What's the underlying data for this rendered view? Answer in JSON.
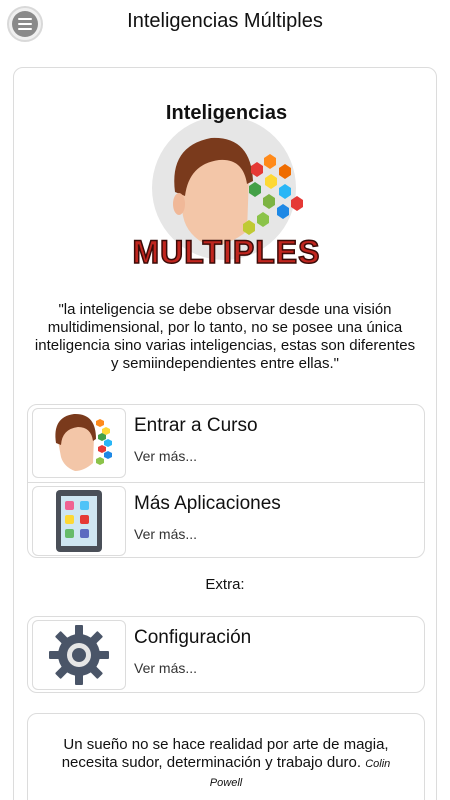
{
  "header": {
    "title": "Inteligencias Múltiples",
    "menu_icon": "menu-icon"
  },
  "hero": {
    "title": "Inteligencias",
    "subtitle": "MULTIPLES"
  },
  "intro_quote": "\"la inteligencia se debe observar desde una visión multidimensional, por lo tanto, no se posee una única inteligencia sino varias inteligencias, estas son diferentes y semiindependientes entre ellas.\"",
  "menu_items": [
    {
      "title": "Entrar a Curso",
      "subtitle": "Ver más...",
      "icon": "head-icon"
    },
    {
      "title": "Más Aplicaciones",
      "subtitle": "Ver más...",
      "icon": "tablet-apps-icon"
    }
  ],
  "extra_label": "Extra:",
  "extra_items": [
    {
      "title": "Configuración",
      "subtitle": "Ver más...",
      "icon": "gear-icon"
    }
  ],
  "footer_quote": {
    "text": "Un sueño no se hace realidad por arte de magia, necesita sudor, determinación y trabajo duro.",
    "author": "Colin Powell"
  },
  "colors": {
    "accent_red": "#c0261f",
    "border": "#dcdcdc",
    "text": "#111111"
  }
}
